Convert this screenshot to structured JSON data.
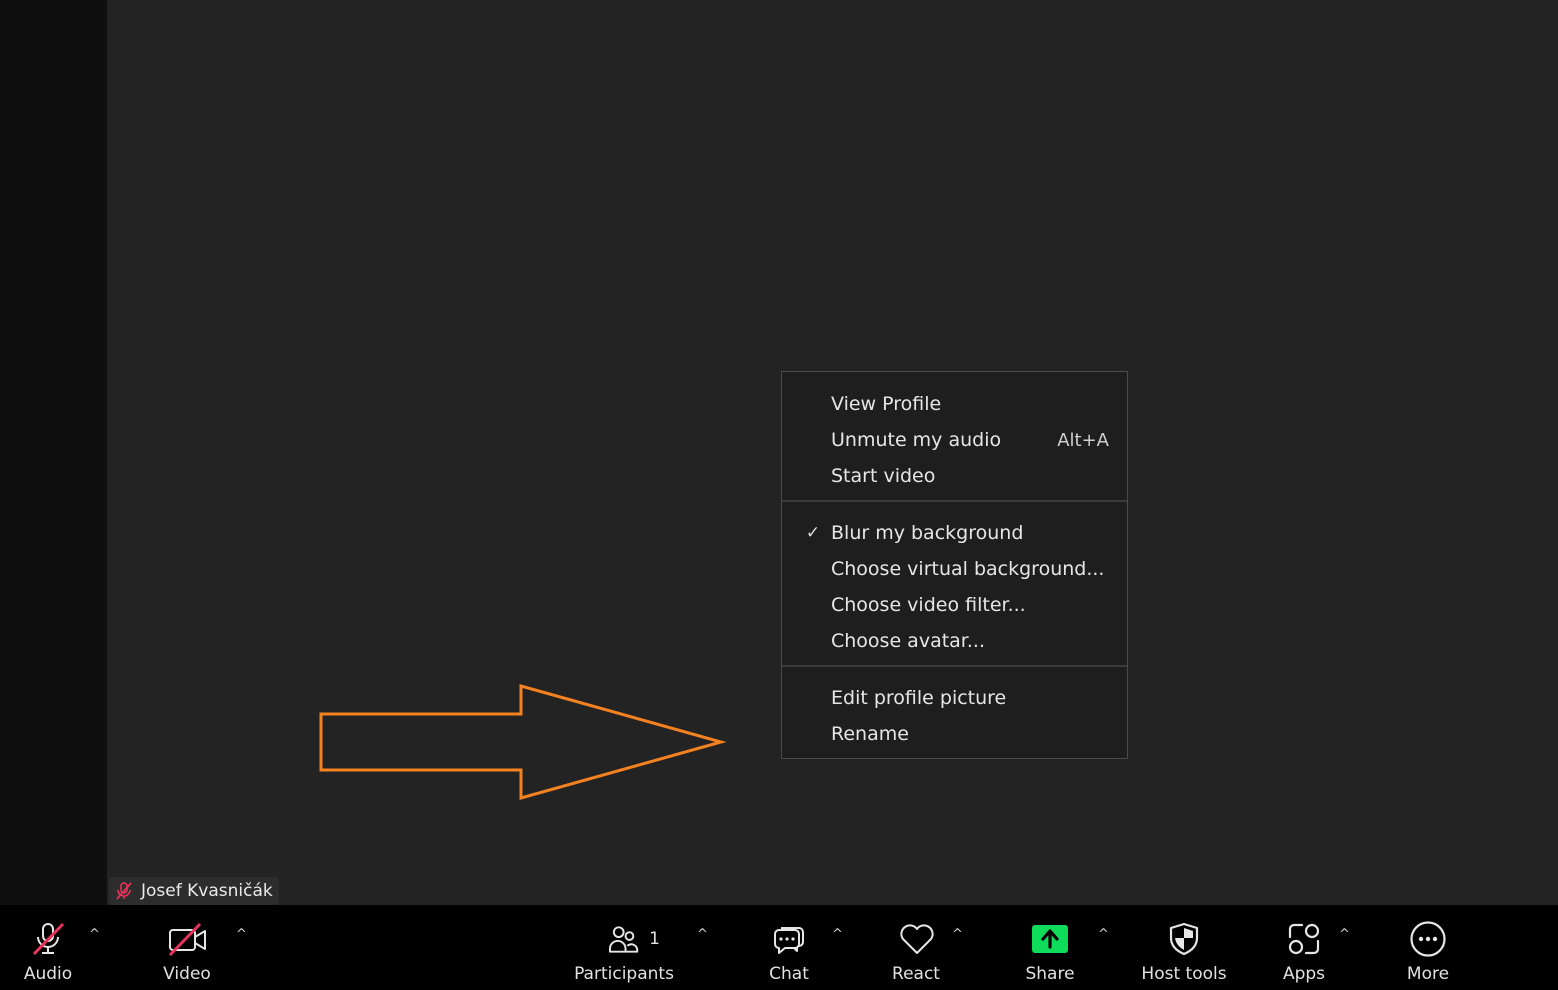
{
  "participant": {
    "name": "Josef Kvasničák"
  },
  "context_menu": {
    "items": [
      {
        "label": "View Profile",
        "shortcut": ""
      },
      {
        "label": "Unmute my audio",
        "shortcut": "Alt+A"
      },
      {
        "label": "Start video",
        "shortcut": ""
      },
      {
        "label": "Blur my background",
        "checked": true
      },
      {
        "label": "Choose virtual background..."
      },
      {
        "label": "Choose video filter..."
      },
      {
        "label": "Choose avatar..."
      },
      {
        "label": "Edit profile picture"
      },
      {
        "label": "Rename"
      }
    ],
    "check_mark": "✓"
  },
  "toolbar": {
    "audio": "Audio",
    "video": "Video",
    "participants": "Participants",
    "participants_count": "1",
    "chat": "Chat",
    "react": "React",
    "share": "Share",
    "host_tools": "Host tools",
    "apps": "Apps",
    "more": "More",
    "caret": "^"
  },
  "colors": {
    "arrow": "#f58220",
    "share_green": "#0fdc5a",
    "muted_red": "#e8335a"
  },
  "icons": {
    "audio": "microphone-muted-icon",
    "video": "camera-off-icon",
    "participants": "people-icon",
    "chat": "chat-bubble-icon",
    "react": "heart-icon",
    "share": "share-up-arrow-icon",
    "host_tools": "shield-icon",
    "apps": "apps-grid-icon",
    "more": "ellipsis-circle-icon"
  }
}
